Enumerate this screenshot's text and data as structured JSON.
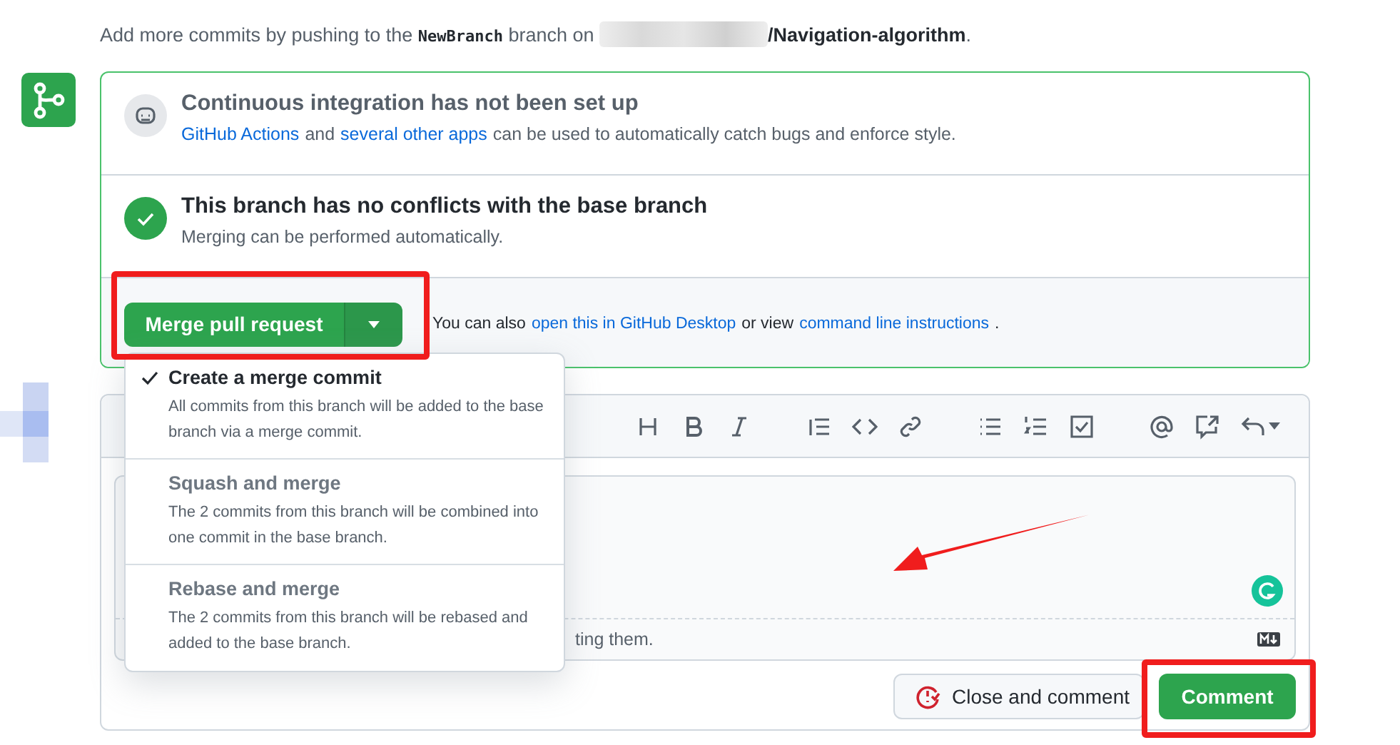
{
  "intro": {
    "before": "Add more commits by pushing to the",
    "branch": "NewBranch",
    "middle": "branch on",
    "repo": "/Navigation-algorithm",
    "end": "."
  },
  "checks": [
    {
      "kind": "ci",
      "title": "Continuous integration has not been set up",
      "parts": [
        {
          "text": "GitHub Actions",
          "link": true
        },
        {
          "text": "and",
          "link": false
        },
        {
          "text": "several other apps",
          "link": true
        },
        {
          "text": "can be used to automatically catch bugs and enforce style.",
          "link": false
        }
      ]
    },
    {
      "kind": "ok",
      "title": "This branch has no conflicts with the base branch",
      "parts": [
        {
          "text": "Merging can be performed automatically.",
          "link": false
        }
      ]
    }
  ],
  "merge": {
    "button": "Merge pull request",
    "parts": [
      {
        "text": "You can also",
        "link": false
      },
      {
        "text": "open this in GitHub Desktop",
        "link": true
      },
      {
        "text": "or view",
        "link": false
      },
      {
        "text": "command line instructions",
        "link": true
      },
      {
        "text": ".",
        "link": false
      }
    ]
  },
  "merge_options": [
    {
      "title": "Create a merge commit",
      "description": "All commits from this branch will be added to the base branch via a merge commit.",
      "selected": true
    },
    {
      "title": "Squash and merge",
      "description": "The 2 commits from this branch will be combined into one commit in the base branch.",
      "selected": false
    },
    {
      "title": "Rebase and merge",
      "description": "The 2 commits from this branch will be rebased and added to the base branch.",
      "selected": false
    }
  ],
  "comment": {
    "hint_tail": "ting them.",
    "close_button": "Close and comment",
    "comment_button": "Comment"
  }
}
